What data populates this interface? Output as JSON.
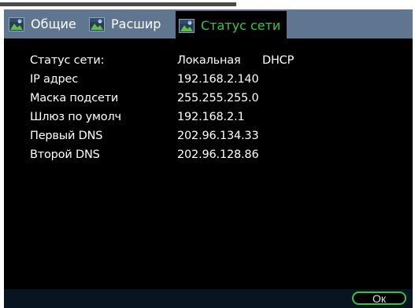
{
  "tabs": [
    {
      "label": "Общие",
      "icon": "network-settings-icon"
    },
    {
      "label": "Расшир",
      "icon": "network-settings-icon"
    },
    {
      "label": "Статус сети",
      "icon": "network-settings-icon",
      "active": true
    }
  ],
  "status": {
    "rows": [
      {
        "label": "Статус сети:",
        "value": "Локальная",
        "extra": "DHCP"
      },
      {
        "label": "IP адрес",
        "value": "192.168.2.140"
      },
      {
        "label": "Маска подсети",
        "value": "255.255.255.0"
      },
      {
        "label": "Шлюз по умолч",
        "value": "192.168.2.1"
      },
      {
        "label": "Первый DNS",
        "value": "202.96.134.33"
      },
      {
        "label": "Второй DNS",
        "value": "202.96.128.86"
      }
    ]
  },
  "ok_label": "Ок",
  "colors": {
    "tabbar": "#5f7590",
    "active_tab_text": "#34c945",
    "ok_border": "#35c24a",
    "background": "#000000"
  }
}
